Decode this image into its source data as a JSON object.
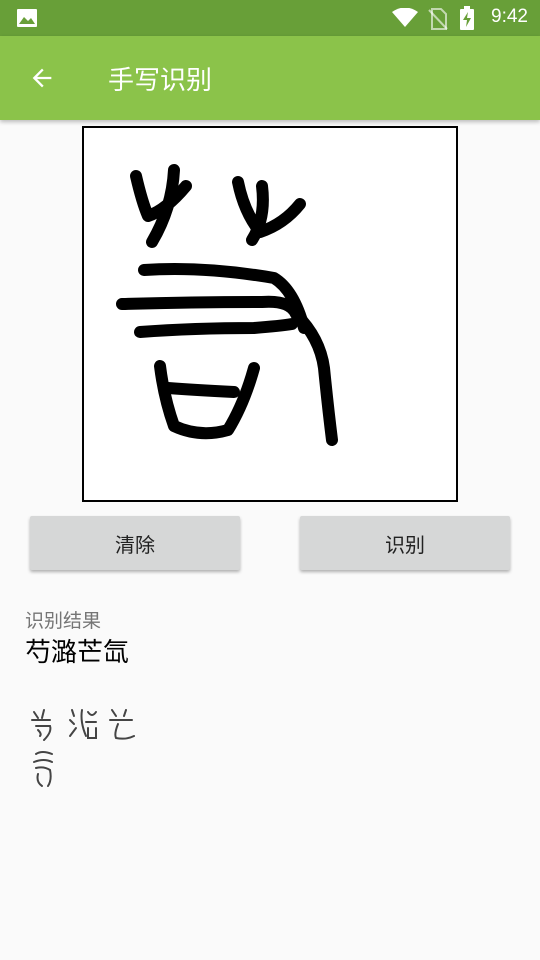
{
  "status_bar": {
    "time": "9:42",
    "icons": [
      "gallery-icon",
      "wifi-icon",
      "no-sim-icon",
      "battery-charging-icon"
    ]
  },
  "app_bar": {
    "title": "手写识别",
    "back_icon": "arrow-left-icon"
  },
  "buttons": {
    "clear_label": "清除",
    "recognize_label": "识别"
  },
  "result": {
    "label": "识别结果",
    "text": "芍潞芒氙"
  },
  "colors": {
    "status_bar": "#689f38",
    "app_bar": "#8bc34a",
    "button": "#d6d7d7"
  }
}
